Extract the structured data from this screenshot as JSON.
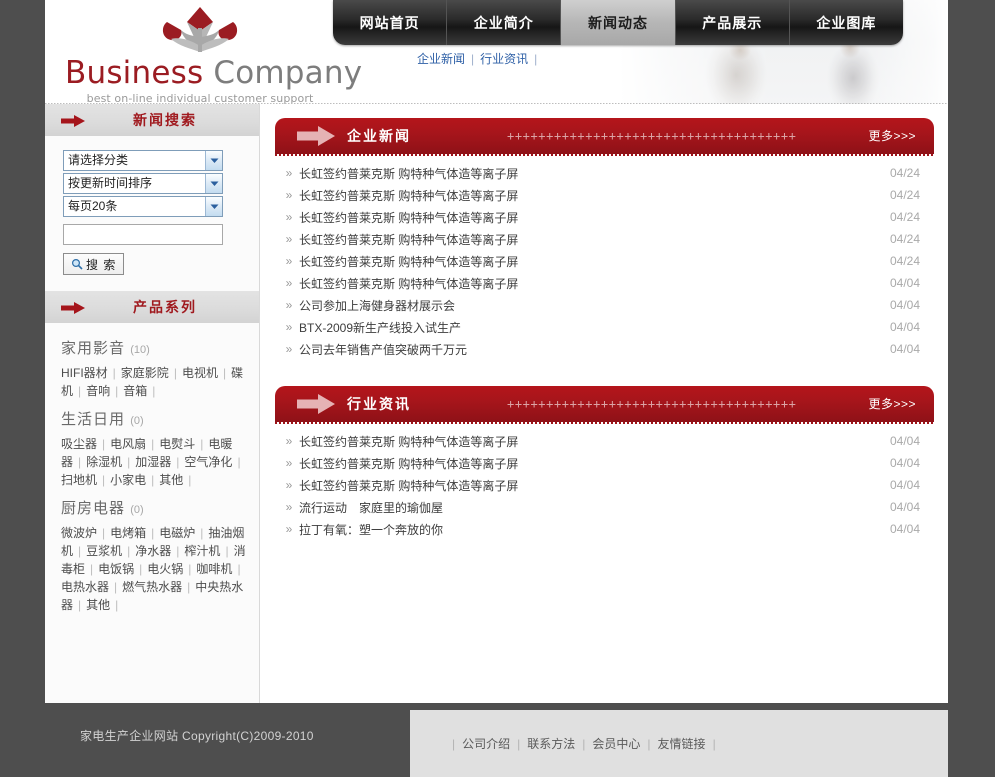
{
  "site": {
    "logo_title_part1": "Business",
    "logo_title_part2": "Company",
    "logo_tagline": "best on-line individual customer support"
  },
  "nav": {
    "items": [
      {
        "label": "网站首页",
        "active": false
      },
      {
        "label": "企业简介",
        "active": false
      },
      {
        "label": "新闻动态",
        "active": true
      },
      {
        "label": "产品展示",
        "active": false
      },
      {
        "label": "企业图库",
        "active": false
      }
    ]
  },
  "subnav": {
    "items": [
      "企业新闻",
      "行业资讯"
    ],
    "separator": "|"
  },
  "sidebar": {
    "search_panel": {
      "title": "新闻搜索",
      "selects": [
        {
          "name": "category",
          "value": "请选择分类"
        },
        {
          "name": "sort",
          "value": "按更新时间排序"
        },
        {
          "name": "pagesize",
          "value": "每页20条"
        }
      ],
      "keyword": "",
      "keyword_placeholder": "",
      "search_button": "搜 索"
    },
    "product_panel": {
      "title": "产品系列",
      "groups": [
        {
          "name": "家用影音",
          "count": "(10)",
          "links": [
            "HIFI器材",
            "家庭影院",
            "电视机",
            "碟机",
            "音响",
            "音箱"
          ]
        },
        {
          "name": "生活日用",
          "count": "(0)",
          "links": [
            "吸尘器",
            "电风扇",
            "电熨斗",
            "电暖器",
            "除湿机",
            "加湿器",
            "空气净化",
            "扫地机",
            "小家电",
            "其他"
          ]
        },
        {
          "name": "厨房电器",
          "count": "(0)",
          "links": [
            "微波炉",
            "电烤箱",
            "电磁炉",
            "抽油烟机",
            "豆浆机",
            "净水器",
            "榨汁机",
            "消毒柜",
            "电饭锅",
            "电火锅",
            "咖啡机",
            "电热水器",
            "燃气热水器",
            "中央热水器",
            "其他"
          ]
        }
      ]
    }
  },
  "main": {
    "panels": [
      {
        "title": "企业新闻",
        "decoration": "+++++++++++++++++++++++++++++++++++++",
        "more": "更多>>>",
        "items": [
          {
            "title": "长虹签约普莱克斯  购特种气体造等离子屏",
            "date": "04/24"
          },
          {
            "title": "长虹签约普莱克斯  购特种气体造等离子屏",
            "date": "04/24"
          },
          {
            "title": "长虹签约普莱克斯  购特种气体造等离子屏",
            "date": "04/24"
          },
          {
            "title": "长虹签约普莱克斯  购特种气体造等离子屏",
            "date": "04/24"
          },
          {
            "title": "长虹签约普莱克斯  购特种气体造等离子屏",
            "date": "04/24"
          },
          {
            "title": "长虹签约普莱克斯  购特种气体造等离子屏",
            "date": "04/04"
          },
          {
            "title": "公司参加上海健身器材展示会",
            "date": "04/04"
          },
          {
            "title": "BTX-2009新生产线投入试生产",
            "date": "04/04"
          },
          {
            "title": "公司去年销售产值突破两千万元",
            "date": "04/04"
          }
        ]
      },
      {
        "title": "行业资讯",
        "decoration": "+++++++++++++++++++++++++++++++++++++",
        "more": "更多>>>",
        "items": [
          {
            "title": "长虹签约普莱克斯  购特种气体造等离子屏",
            "date": "04/04"
          },
          {
            "title": "长虹签约普莱克斯  购特种气体造等离子屏",
            "date": "04/04"
          },
          {
            "title": "长虹签约普莱克斯  购特种气体造等离子屏",
            "date": "04/04"
          },
          {
            "title": "流行运动　家庭里的瑜伽屋",
            "date": "04/04"
          },
          {
            "title": "拉丁有氧：塑一个奔放的你",
            "date": "04/04"
          }
        ]
      }
    ],
    "bullet": "»"
  },
  "footer": {
    "copyright": "家电生产企业网站  Copyright(C)2009-2010",
    "links": [
      "公司介绍",
      "联系方法",
      "会员中心",
      "友情链接"
    ],
    "separator": "|"
  },
  "colors": {
    "brand_red": "#a5151b",
    "logo_red": "#9b1c22",
    "dark_chrome": "#4e4e4e",
    "link_blue": "#2d5fa6"
  }
}
